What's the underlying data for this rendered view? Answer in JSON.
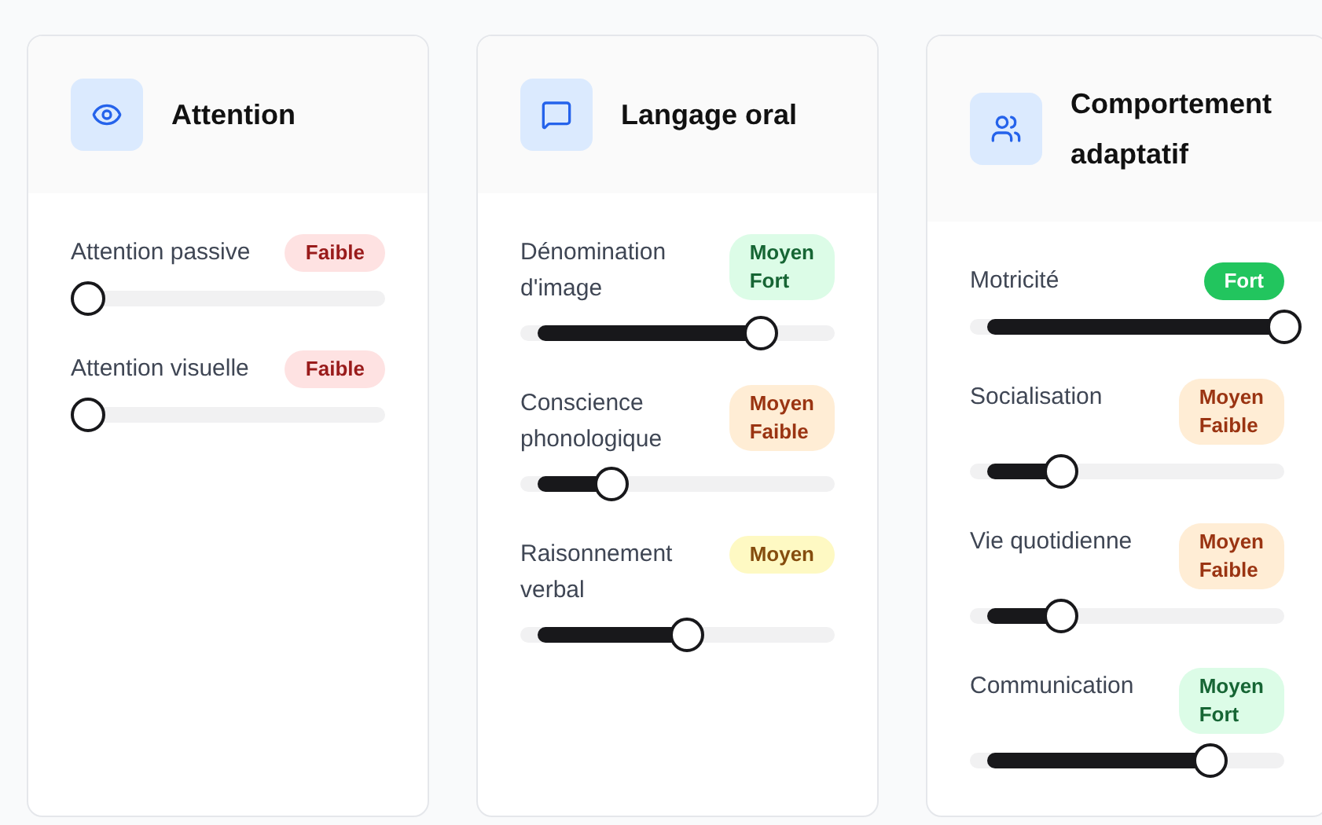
{
  "cards": [
    {
      "title": "Attention",
      "skills": [
        {
          "name": "Attention passive",
          "badge": {
            "kind": "faible",
            "text": "Faible"
          },
          "level": 0
        },
        {
          "name": "Attention visuelle",
          "badge": {
            "kind": "faible",
            "text": "Faible"
          },
          "level": 0
        }
      ]
    },
    {
      "title": "Langage oral",
      "skills": [
        {
          "name": "Dénomination d'image",
          "badge": {
            "kind": "moyen-fort",
            "text": "Moyen Fort"
          },
          "level": 0.75
        },
        {
          "name": "Conscience phonologique",
          "badge": {
            "kind": "moyen-faible",
            "text": "Moyen Faible"
          },
          "level": 0.25
        },
        {
          "name": "Raisonnement verbal",
          "badge": {
            "kind": "moyen",
            "text": "Moyen"
          },
          "level": 0.5
        }
      ]
    },
    {
      "title": "Comportement adaptatif",
      "skills": [
        {
          "name": "Motricité",
          "badge": {
            "kind": "fort",
            "text": "Fort"
          },
          "level": 1
        },
        {
          "name": "Socialisation",
          "badge": {
            "kind": "moyen-faible",
            "text": "Moyen Faible"
          },
          "level": 0.25
        },
        {
          "name": "Vie quotidienne",
          "badge": {
            "kind": "moyen-faible",
            "text": "Moyen Faible"
          },
          "level": 0.25
        },
        {
          "name": "Communication",
          "badge": {
            "kind": "moyen-fort",
            "text": "Moyen Fort"
          },
          "level": 0.75
        }
      ]
    }
  ]
}
